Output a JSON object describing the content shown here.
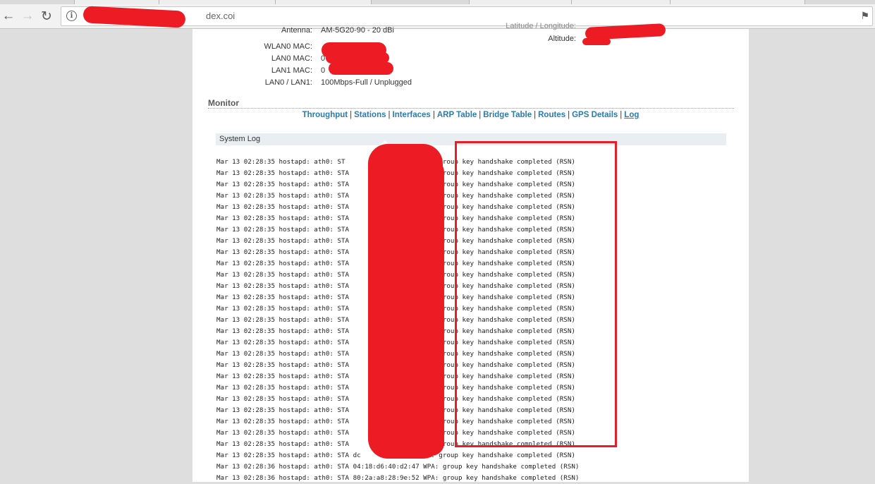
{
  "browser": {
    "url_visible": "dex.coi"
  },
  "device_info": {
    "antenna": {
      "label": "Antenna:",
      "value": "AM-5G20-90 - 20 dBi"
    },
    "wlan0_mac": {
      "label": "WLAN0 MAC:",
      "value": ""
    },
    "lan0_mac": {
      "label": "LAN0 MAC:",
      "value": "0"
    },
    "lan1_mac": {
      "label": "LAN1 MAC:",
      "value": "0"
    },
    "lan_status": {
      "label": "LAN0 / LAN1:",
      "value": "100Mbps-Full / Unplugged"
    },
    "lat_long": {
      "label": "Latitude / Longitude:",
      "value": ""
    },
    "altitude": {
      "label": "Altitude:",
      "value": ""
    }
  },
  "monitor": {
    "title": "Monitor",
    "nav": [
      "Throughput",
      "Stations",
      "Interfaces",
      "ARP Table",
      "Bridge Table",
      "Routes",
      "GPS Details",
      "Log"
    ],
    "active": "Log"
  },
  "system_log": {
    "title": "System Log",
    "lines": [
      "Mar 13 02:28:35 hostapd: ath0: ST               :   WPA: group key handshake completed (RSN)",
      "Mar 13 02:28:35 hostapd: ath0: STA                  WPA: group key handshake completed (RSN)",
      "Mar 13 02:28:35 hostapd: ath0: STA                  WPA: group key handshake completed (RSN)",
      "Mar 13 02:28:35 hostapd: ath0: STA                  WPA: group key handshake completed (RSN)",
      "Mar 13 02:28:35 hostapd: ath0: STA                  WPA: group key handshake completed (RSN)",
      "Mar 13 02:28:35 hostapd: ath0: STA                  WPA: group key handshake completed (RSN)",
      "Mar 13 02:28:35 hostapd: ath0: STA                  WPA: group key handshake completed (RSN)",
      "Mar 13 02:28:35 hostapd: ath0: STA                  WPA: group key handshake completed (RSN)",
      "Mar 13 02:28:35 hostapd: ath0: STA                  WPA: group key handshake completed (RSN)",
      "Mar 13 02:28:35 hostapd: ath0: STA                  WPA: group key handshake completed (RSN)",
      "Mar 13 02:28:35 hostapd: ath0: STA                  WPA: group key handshake completed (RSN)",
      "Mar 13 02:28:35 hostapd: ath0: STA                  WPA: group key handshake completed (RSN)",
      "Mar 13 02:28:35 hostapd: ath0: STA                  WPA: group key handshake completed (RSN)",
      "Mar 13 02:28:35 hostapd: ath0: STA                  WPA: group key handshake completed (RSN)",
      "Mar 13 02:28:35 hostapd: ath0: STA                  WPA: group key handshake completed (RSN)",
      "Mar 13 02:28:35 hostapd: ath0: STA                  WPA: group key handshake completed (RSN)",
      "Mar 13 02:28:35 hostapd: ath0: STA                  WPA: group key handshake completed (RSN)",
      "Mar 13 02:28:35 hostapd: ath0: STA                  WPA: group key handshake completed (RSN)",
      "Mar 13 02:28:35 hostapd: ath0: STA                  WPA: group key handshake completed (RSN)",
      "Mar 13 02:28:35 hostapd: ath0: STA                  WPA: group key handshake completed (RSN)",
      "Mar 13 02:28:35 hostapd: ath0: STA                  WPA: group key handshake completed (RSN)",
      "Mar 13 02:28:35 hostapd: ath0: STA                  WPA: group key handshake completed (RSN)",
      "Mar 13 02:28:35 hostapd: ath0: STA                  WPA: group key handshake completed (RSN)",
      "Mar 13 02:28:35 hostapd: ath0: STA                  WPA: group key handshake completed (RSN)",
      "Mar 13 02:28:35 hostapd: ath0: STA                  WPA: group key handshake completed (RSN)",
      "Mar 13 02:28:35 hostapd: ath0: STA                  WPA: group key handshake completed (RSN)",
      "Mar 13 02:28:35 hostapd: ath0: STA dc     b:f4   :  WPA: group key handshake completed (RSN)",
      "Mar 13 02:28:36 hostapd: ath0: STA 04:18:d6:40:d2:47 WPA: group key handshake completed (RSN)",
      "Mar 13 02:28:36 hostapd: ath0: STA 80:2a:a8:28:9e:52 WPA: group key handshake completed (RSN)"
    ]
  },
  "colors": {
    "link": "#2b7bb0",
    "redaction": "#ed1c24",
    "log_header_bg": "#e8eef1"
  },
  "icons": {
    "back": "arrow-left",
    "forward": "arrow-right",
    "reload": "circular-arrow",
    "info": "info-circle",
    "bookmark": "bookmark-icon"
  }
}
